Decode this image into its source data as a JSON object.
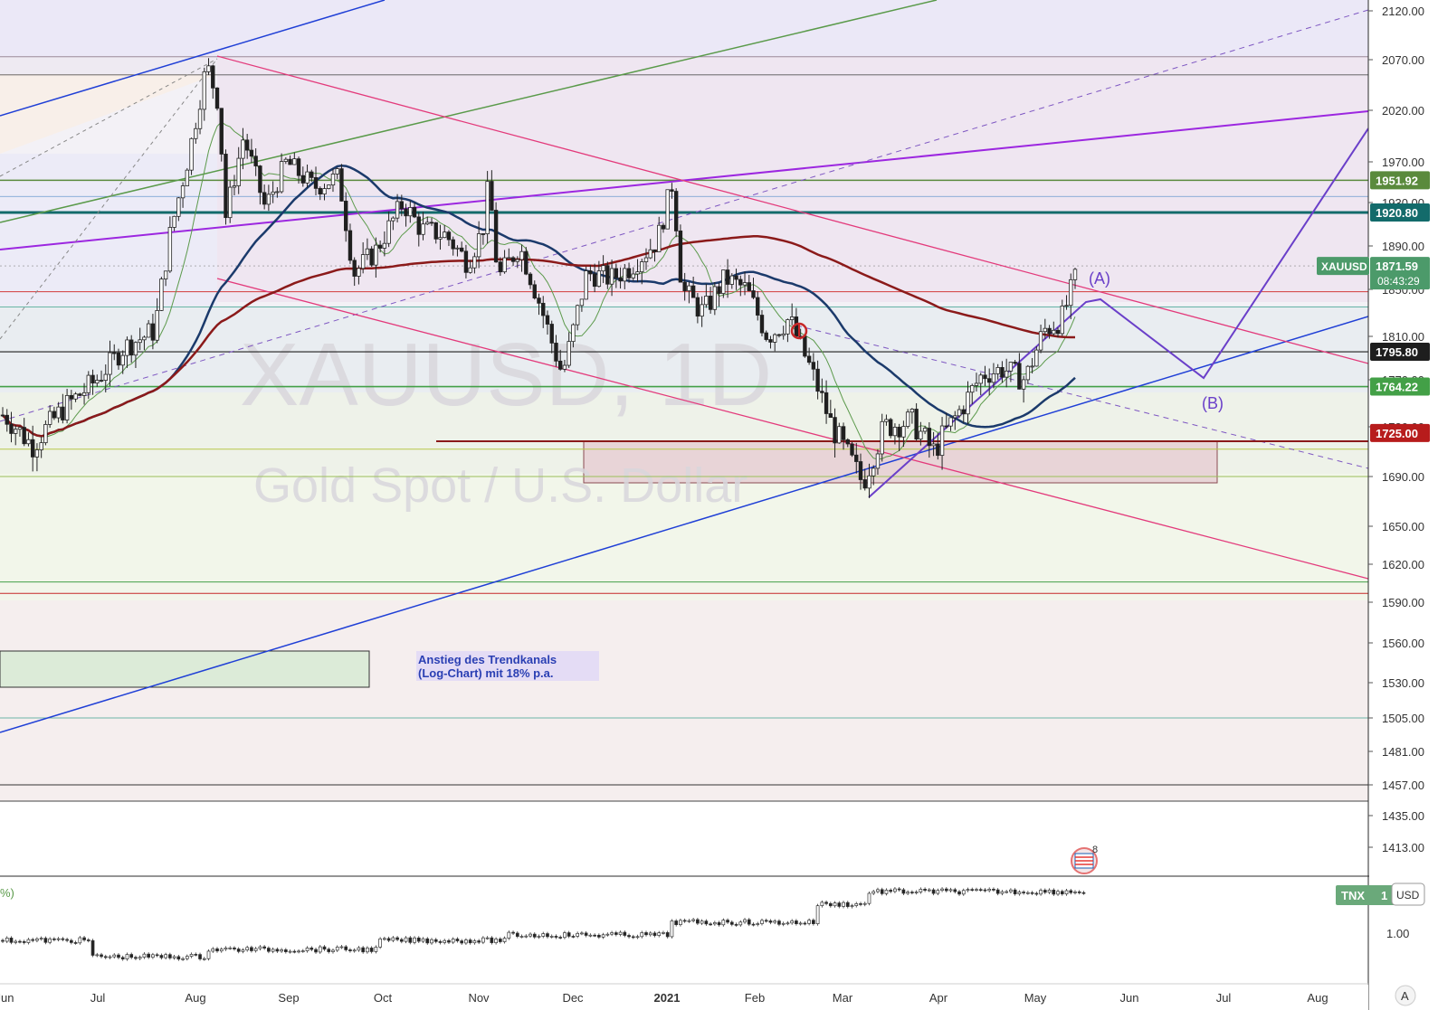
{
  "symbol_watermark": "XAUUSD, 1D",
  "name_watermark": "Gold Spot / U.S. Dollar",
  "chart_data": {
    "type": "candlestick",
    "symbol": "XAUUSD",
    "interval": "1D",
    "ylim": [
      1400,
      2130
    ],
    "price_ticks": [
      2120.0,
      2070.0,
      2020.0,
      1970.0,
      1930.0,
      1890.0,
      1850.0,
      1810.0,
      1770.0,
      1730.0,
      1690.0,
      1650.0,
      1620.0,
      1590.0,
      1560.0,
      1530.0,
      1505.0,
      1481.0,
      1457.0,
      1435.0,
      1413.0
    ],
    "time_ticks": [
      "Jun",
      "Jul",
      "Aug",
      "Sep",
      "Oct",
      "Nov",
      "Dec",
      "2021",
      "Feb",
      "Mar",
      "Apr",
      "May",
      "Jun",
      "Jul",
      "Aug"
    ],
    "highlighted_levels": [
      {
        "value": "1951.92",
        "color": "#5a8a3c"
      },
      {
        "value": "1920.80",
        "color": "#136b6b"
      },
      {
        "value": "1795.80",
        "color": "#1e1e1e"
      },
      {
        "value": "1764.22",
        "color": "#43a047"
      },
      {
        "value": "1725.00",
        "color": "#b71c1c"
      }
    ],
    "last_price": {
      "symbol": "XAUUSD",
      "value": "1871.59",
      "countdown": "08:43:29",
      "color": "#4c9a6a"
    },
    "close_path": [
      [
        "2020-06-01",
        1740
      ],
      [
        "2020-06-10",
        1715
      ],
      [
        "2020-06-20",
        1745
      ],
      [
        "2020-07-01",
        1770
      ],
      [
        "2020-07-10",
        1800
      ],
      [
        "2020-07-20",
        1815
      ],
      [
        "2020-07-25",
        1900
      ],
      [
        "2020-07-31",
        1975
      ],
      [
        "2020-08-06",
        2065
      ],
      [
        "2020-08-10",
        2025
      ],
      [
        "2020-08-12",
        1915
      ],
      [
        "2020-08-18",
        1995
      ],
      [
        "2020-08-25",
        1925
      ],
      [
        "2020-09-01",
        1970
      ],
      [
        "2020-09-10",
        1945
      ],
      [
        "2020-09-18",
        1955
      ],
      [
        "2020-09-23",
        1865
      ],
      [
        "2020-09-30",
        1885
      ],
      [
        "2020-10-09",
        1930
      ],
      [
        "2020-10-15",
        1905
      ],
      [
        "2020-10-23",
        1900
      ],
      [
        "2020-10-30",
        1875
      ],
      [
        "2020-11-04",
        1905
      ],
      [
        "2020-11-06",
        1950
      ],
      [
        "2020-11-09",
        1860
      ],
      [
        "2020-11-16",
        1890
      ],
      [
        "2020-11-23",
        1835
      ],
      [
        "2020-11-30",
        1775
      ],
      [
        "2020-12-08",
        1865
      ],
      [
        "2020-12-16",
        1860
      ],
      [
        "2020-12-22",
        1870
      ],
      [
        "2020-12-31",
        1895
      ],
      [
        "2021-01-05",
        1950
      ],
      [
        "2021-01-08",
        1850
      ],
      [
        "2021-01-15",
        1830
      ],
      [
        "2021-01-22",
        1860
      ],
      [
        "2021-01-29",
        1850
      ],
      [
        "2021-02-05",
        1810
      ],
      [
        "2021-02-12",
        1825
      ],
      [
        "2021-02-19",
        1780
      ],
      [
        "2021-02-26",
        1730
      ],
      [
        "2021-03-08",
        1685
      ],
      [
        "2021-03-15",
        1730
      ],
      [
        "2021-03-24",
        1735
      ],
      [
        "2021-03-31",
        1710
      ],
      [
        "2021-04-09",
        1745
      ],
      [
        "2021-04-16",
        1775
      ],
      [
        "2021-04-23",
        1780
      ],
      [
        "2021-04-30",
        1770
      ],
      [
        "2021-05-06",
        1815
      ],
      [
        "2021-05-12",
        1825
      ],
      [
        "2021-05-17",
        1865
      ]
    ],
    "projection_labels": [
      "(A)",
      "(B)"
    ],
    "annotation": [
      "Anstieg des Trendkanals",
      "(Log-Chart) mit 18% p.a."
    ],
    "event_badge_count": "8"
  },
  "lower_pane": {
    "symbol": "TNX",
    "symbol_suffix": "1",
    "currency_button": "USD",
    "tick": "1.00",
    "left_label": "%)"
  },
  "corner_button": "A"
}
